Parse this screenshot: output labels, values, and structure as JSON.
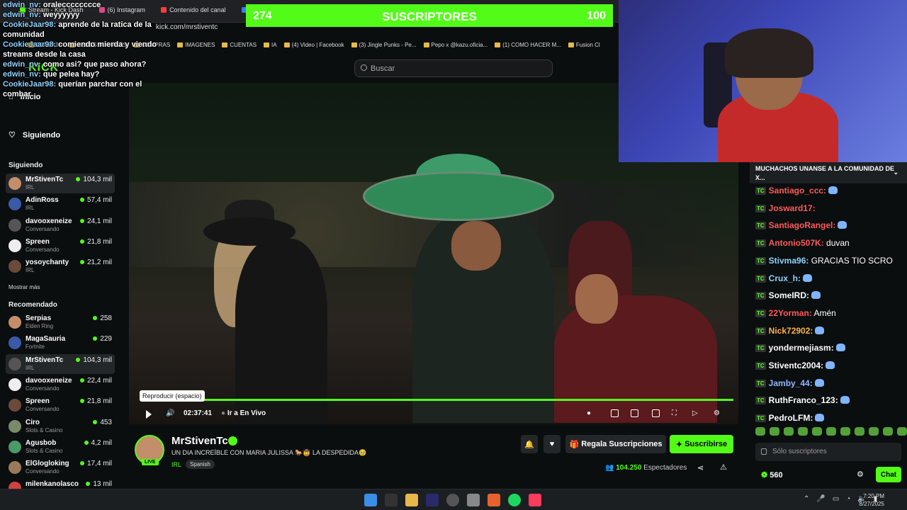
{
  "browser": {
    "tabs": [
      "Stream - Kick Dash",
      "(6) Instagram",
      "Contenido del canal",
      "Facebook"
    ],
    "url": "kick.com/mrstiventc",
    "bookmarks": [
      "TRABAJO",
      "REDES SOCIALES",
      "COMPRAS",
      "IMAGENES",
      "CUENTAS",
      "IA",
      "(4) Video | Facebook",
      "(3) Jingle Punks - Pe...",
      "Pepo x @kazu.oficia...",
      "(1) COMO HACER M...",
      "Fusion Cl"
    ]
  },
  "header": {
    "logo": "KICK",
    "search_placeholder": "Buscar"
  },
  "sidebar": {
    "nav": [
      {
        "label": "Inicio",
        "icon": "home-icon"
      },
      {
        "label": "Siguiendo",
        "icon": "heart-icon"
      }
    ],
    "following_title": "Siguiendo",
    "following": [
      {
        "name": "MrStivenTc",
        "category": "IRL",
        "viewers": "104,3 mil",
        "active": true
      },
      {
        "name": "AdinRoss",
        "category": "IRL",
        "viewers": "57,4 mil"
      },
      {
        "name": "davooxeneize",
        "category": "Conversando",
        "viewers": "24,1 mil"
      },
      {
        "name": "Spreen",
        "category": "Conversando",
        "viewers": "21,8 mil"
      },
      {
        "name": "yosoychanty",
        "category": "IRL",
        "viewers": "21,2 mil"
      }
    ],
    "show_more": "Mostrar más",
    "recommended_title": "Recomendado",
    "recommended": [
      {
        "name": "Serpias",
        "category": "Elden Ring",
        "viewers": "258"
      },
      {
        "name": "MagaSauria",
        "category": "Fortnite",
        "viewers": "229"
      },
      {
        "name": "MrStivenTc",
        "category": "IRL",
        "viewers": "104,3 mil",
        "active": true
      },
      {
        "name": "davooxeneize",
        "category": "Conversando",
        "viewers": "22,4 mil"
      },
      {
        "name": "Spreen",
        "category": "Conversando",
        "viewers": "21,8 mil"
      },
      {
        "name": "Ciro",
        "category": "Slots & Casino",
        "viewers": "453"
      },
      {
        "name": "Agusbob",
        "category": "Slots & Casino",
        "viewers": "4,2 mil"
      },
      {
        "name": "ElGlogloking",
        "category": "Conversando",
        "viewers": "17,4 mil"
      },
      {
        "name": "milenkanolasco",
        "category": "",
        "viewers": "13 mil"
      }
    ]
  },
  "overlay_chat": [
    {
      "user": "edwin_nv:",
      "text": "oralecccccccce"
    },
    {
      "user": "edwin_nv:",
      "text": "weyyyyyy"
    },
    {
      "user": "CookieJaar98:",
      "text": "aprende de la ratica de la comunidad"
    },
    {
      "user": "CookieJaar98:",
      "text": "comiendo mierda y viendo streams desde la casa"
    },
    {
      "user": "edwin_nv:",
      "text": "como asi? que paso ahora?"
    },
    {
      "user": "edwin_nv:",
      "text": "que pelea hay?"
    },
    {
      "user": "CookieJaar98:",
      "text": "querían parchar con el combar"
    }
  ],
  "sub_goal": {
    "current": "274",
    "label": "SUSCRIPTORES",
    "target": "100",
    "progress": 1.0
  },
  "player": {
    "tooltip": "Reproducir (espacio)",
    "time": "02:37:41",
    "live_link": "Ir a En Vivo",
    "progress": 1.0
  },
  "channel": {
    "name": "MrStivenTc",
    "live_badge": "LIVE",
    "title": "UN DIA INCREÍBLE CON MARIA JULISSA 🐎🤠 LA DESPEDIDA🥹",
    "category": "IRL",
    "language": "Spanish",
    "gift_button": "Regala Suscripciones",
    "subscribe_button": "Suscribirse",
    "viewers": "104.250",
    "viewers_label": "Espectadores"
  },
  "chat": {
    "pinned": "MUCHACHOS UNANSE A LA COMUNIDAD DE X...",
    "messages": [
      {
        "user": "Santiago_ccc:",
        "color": "#ff5a5a",
        "text": "",
        "emote": true
      },
      {
        "user": "Josward17:",
        "color": "#ff5a5a",
        "text": "",
        "emote": false
      },
      {
        "user": "SantiagoRangel:",
        "color": "#ff5a5a",
        "text": "",
        "emote": true
      },
      {
        "user": "Antonio507K:",
        "color": "#ff5a5a",
        "text": "duvan",
        "emote": false
      },
      {
        "user": "Stivma96:",
        "color": "#8fd2ff",
        "text": "GRACIAS TIO SCRO",
        "emote": false
      },
      {
        "user": "Crux_h:",
        "color": "#8fd2ff",
        "text": "",
        "emote": true
      },
      {
        "user": "SomeIRD:",
        "color": "#ffffff",
        "text": "",
        "emote": true
      },
      {
        "user": "22Yorman:",
        "color": "#ff5a5a",
        "text": "Amén",
        "emote": false
      },
      {
        "user": "Nick72902:",
        "color": "#ffb347",
        "text": "",
        "emote": true
      },
      {
        "user": "yondermejiasm:",
        "color": "#ffffff",
        "text": "",
        "emote": true
      },
      {
        "user": "Stiventc2004:",
        "color": "#ffffff",
        "text": "",
        "emote": true
      },
      {
        "user": "Jamby_44:",
        "color": "#8fb8ff",
        "text": "",
        "emote": true
      },
      {
        "user": "RuthFranco_123:",
        "color": "#ffffff",
        "text": "",
        "emote": true
      },
      {
        "user": "PedroLFM:",
        "color": "#ffffff",
        "text": "",
        "emote": true
      }
    ],
    "input_placeholder": "Sólo suscriptores",
    "points": "560",
    "chat_button": "Chat"
  },
  "taskbar": {
    "time": "7:20 PM",
    "date": "8/27/2025"
  }
}
